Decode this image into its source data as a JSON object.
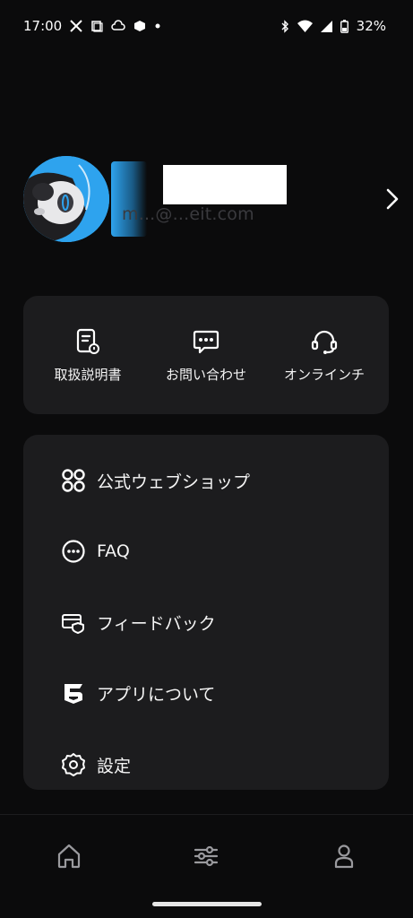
{
  "status_bar": {
    "time": "17:00",
    "battery": "32%",
    "icons_left": [
      "x-icon",
      "screen-icon",
      "cloud-icon",
      "app-icon",
      "dot-icon"
    ],
    "icons_right": [
      "bluetooth-icon",
      "wifi-icon",
      "signal-icon",
      "battery-icon"
    ]
  },
  "profile": {
    "email": "m...@...eit.com",
    "name_redacted": true
  },
  "quick_actions": [
    {
      "label": "取扱説明書",
      "icon": "manual-icon"
    },
    {
      "label": "お問い合わせ",
      "icon": "chat-icon"
    },
    {
      "label": "オンラインチ",
      "icon": "headset-icon"
    }
  ],
  "menu": [
    {
      "label": "公式ウェブショップ",
      "icon": "shop-grid-icon"
    },
    {
      "label": "FAQ",
      "icon": "faq-icon"
    },
    {
      "label": "フィードバック",
      "icon": "feedback-icon"
    },
    {
      "label": "アプリについて",
      "icon": "about-app-icon"
    },
    {
      "label": "設定",
      "icon": "settings-gear-icon"
    }
  ],
  "bottom_nav": [
    {
      "name": "home",
      "icon": "home-icon"
    },
    {
      "name": "controls",
      "icon": "sliders-icon"
    },
    {
      "name": "profile",
      "icon": "person-icon"
    }
  ],
  "colors": {
    "background": "#0b0b0c",
    "card": "#1c1c1e",
    "text": "#f5f5f5",
    "avatar_accent": "#2ea3ee"
  }
}
